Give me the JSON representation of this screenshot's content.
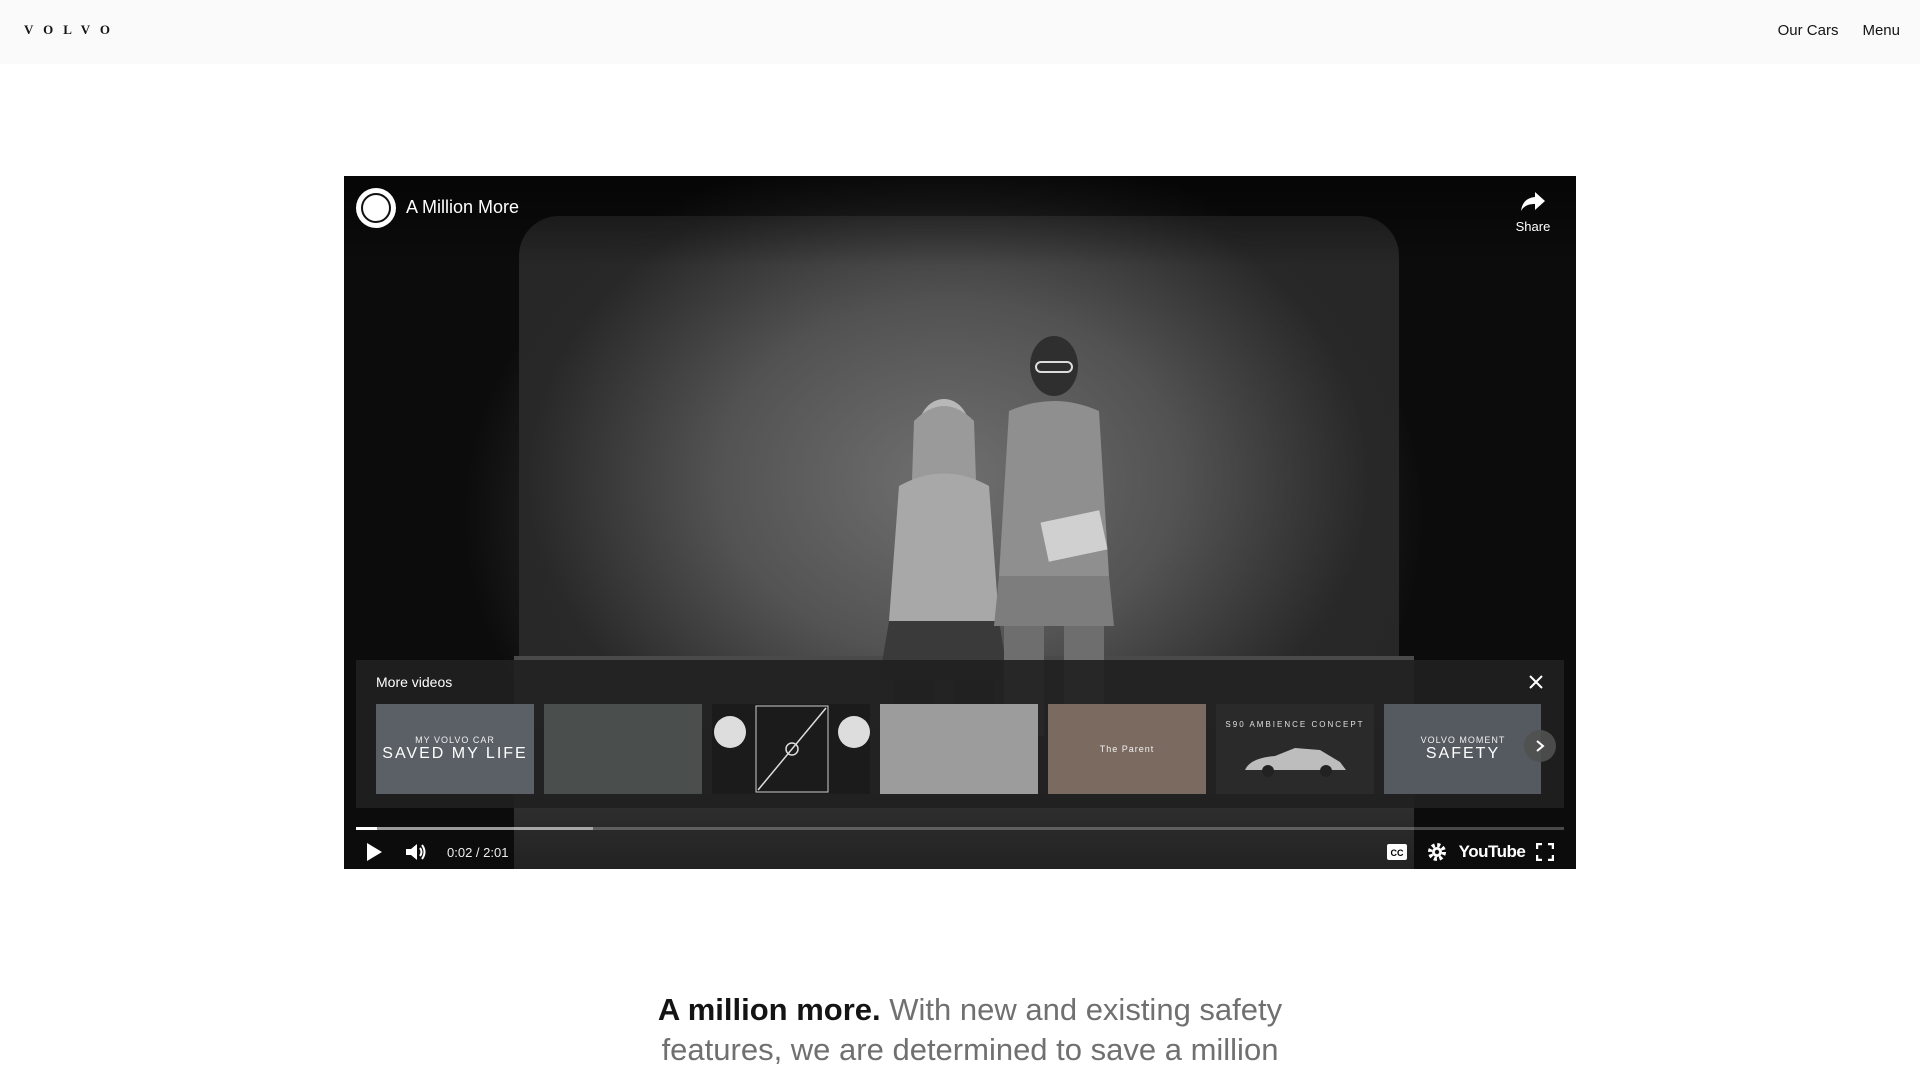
{
  "header": {
    "logo": "VOLVO",
    "nav": [
      "Our Cars",
      "Menu"
    ]
  },
  "video": {
    "title": "A Million More",
    "share_label": "Share",
    "time": "0:02 / 2:01",
    "progress_played": 0.017,
    "progress_loaded": 0.196,
    "more_videos_title": "More videos",
    "youtube_label": "YouTube",
    "thumbnails": [
      {
        "small": "MY VOLVO CAR",
        "big": "SAVED MY LIFE",
        "bg": "#5a6066"
      },
      {
        "small": "",
        "big": "",
        "bg": "#4a4e4c"
      },
      {
        "small": "",
        "big": "",
        "bg": "#1b1b1b"
      },
      {
        "small": "",
        "big": "",
        "bg": "#9c9c9c"
      },
      {
        "small": "The Parent",
        "big": "",
        "bg": "#7a6a60"
      },
      {
        "small": "S90 AMBIENCE CONCEPT",
        "big": "",
        "bg": "#2a2a2a"
      },
      {
        "small": "VOLVO MOMENT",
        "big": "SAFETY",
        "bg": "#555a60"
      }
    ]
  },
  "headline": {
    "strong": "A million more.",
    "soft": "With new and existing safety features, we are determined to save a million"
  },
  "icons": [
    "share-icon",
    "close-icon",
    "chevron-right-icon",
    "play-icon",
    "volume-icon",
    "cc-icon",
    "settings-icon",
    "fullscreen-icon"
  ]
}
